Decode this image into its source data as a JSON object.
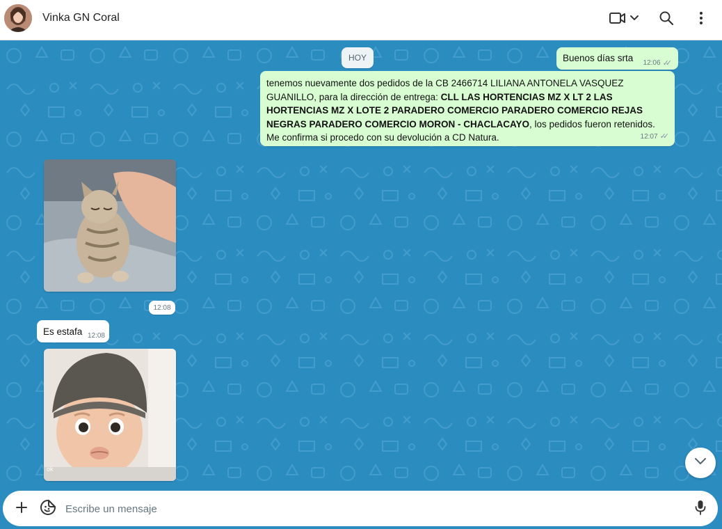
{
  "header": {
    "contact_name": "Vinka GN Coral"
  },
  "chat": {
    "day_label": "HOY",
    "messages": [
      {
        "direction": "out",
        "text": "Buenos días srta",
        "time": "12:06",
        "status": "read"
      },
      {
        "direction": "out",
        "text_before": "tenemos nuevamente dos pedidos de la CB 2466714 LILIANA ANTONELA VASQUEZ GUANILLO, para la dirección de entrega: ",
        "text_bold": "CLL LAS HORTENCIAS MZ X LT 2 LAS HORTENCIAS MZ X LOTE 2 PARADERO COMERCIO PARADERO COMERCIO REJAS NEGRAS PARADERO COMERCIO MORON - CHACLACAYO",
        "text_after": ", los pedidos fueron retenidos. Me confirma si procedo con su devolución a CD Natura.",
        "time": "12:07",
        "status": "read"
      },
      {
        "direction": "in",
        "type": "image",
        "subject": "kitten-gif"
      },
      {
        "direction": "in",
        "type": "time-chip",
        "time": "12:08"
      },
      {
        "direction": "in",
        "text": "Es estafa",
        "time": "12:08"
      },
      {
        "direction": "in",
        "type": "image",
        "subject": "baby-gif",
        "overlay_text": "ok"
      }
    ]
  },
  "composer": {
    "placeholder": "Escribe un mensaje"
  },
  "icons": {
    "video": "video-camera-icon",
    "search": "search-icon",
    "menu": "kebab-menu-icon",
    "attach": "plus-icon",
    "sticker": "sticker-icon",
    "mic": "microphone-icon",
    "scroll_down": "chevron-down-icon"
  },
  "colors": {
    "wallpaper": "#2b8cc0",
    "outgoing_bubble": "#d9fdd3",
    "incoming_bubble": "#ffffff",
    "header_bg": "#ffffff"
  }
}
